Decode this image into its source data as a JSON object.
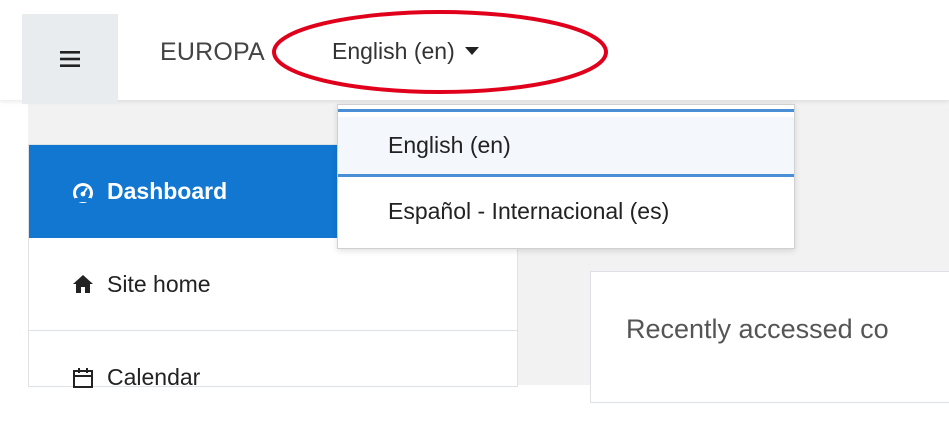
{
  "navbar": {
    "brand": "EUROPA",
    "language_current": "English (en)"
  },
  "language_menu": {
    "options": [
      "English (en)",
      "Español - Internacional (es)"
    ],
    "selected": "English (en)"
  },
  "drawer": {
    "items": [
      {
        "label": "Dashboard",
        "icon": "dashboard-icon",
        "active": true
      },
      {
        "label": "Site home",
        "icon": "home-icon"
      },
      {
        "label": "Calendar",
        "icon": "calendar-icon"
      }
    ]
  },
  "main": {
    "card_title": "Recently accessed co"
  },
  "colors": {
    "accent": "#1177d1",
    "annotation": "#e0001b",
    "hamburger_bg": "#e9ecef",
    "page_bg": "#f2f2f2",
    "dropdown_highlight": "#4a8fd6"
  }
}
